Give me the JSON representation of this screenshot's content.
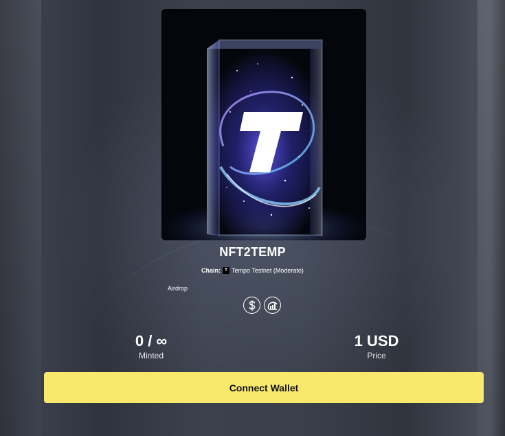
{
  "collection": {
    "name": "NFT2TEMP",
    "artwork": {
      "alt": "Glass block with glowing T logo",
      "logo_letter": "T"
    }
  },
  "chain": {
    "label": "Chain:",
    "icon": "T",
    "name": "Tempo Testnet (Moderato)"
  },
  "tag": "Airdrop",
  "icons": {
    "currency": "dollar-icon",
    "stats": "chart-icon"
  },
  "stats": {
    "minted": {
      "value": "0 / ∞",
      "label": "Minted"
    },
    "price": {
      "value": "1 USD",
      "label": "Price"
    }
  },
  "actions": {
    "connect_label": "Connect Wallet"
  },
  "colors": {
    "button": "#f8e86c",
    "button_text": "#111111",
    "background": "#363a45"
  }
}
